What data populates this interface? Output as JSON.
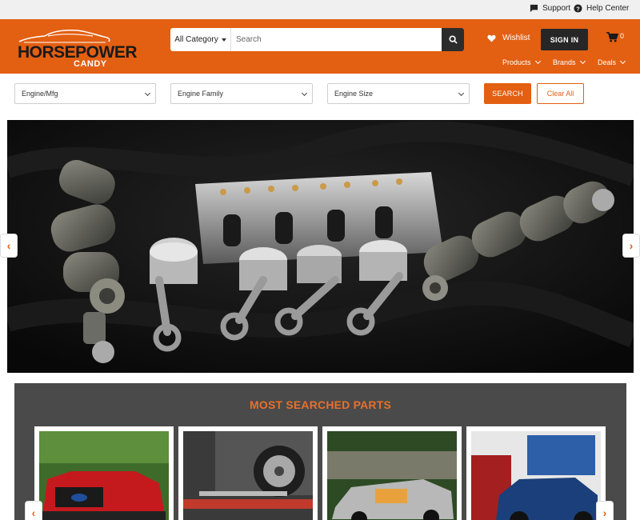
{
  "topbar": {
    "support": "Support",
    "help": "Help Center"
  },
  "brand": {
    "line1": "HORSEPOWER",
    "line2": "CANDY"
  },
  "search": {
    "category": "All Category",
    "placeholder": "Search"
  },
  "header": {
    "wishlist": "Wishlist",
    "signin": "SIGN IN",
    "cart_count": "0"
  },
  "nav": [
    "Products",
    "Brands",
    "Deals"
  ],
  "filters": {
    "engine_mfg": "Engine/Mfg",
    "engine_family": "Engine Family",
    "engine_size": "Engine Size",
    "search_btn": "SEARCH",
    "clear_btn": "Clear All"
  },
  "carousel": {
    "prev": "‹",
    "next": "›"
  },
  "most_searched": {
    "title": "MOST SEARCHED PARTS",
    "prev": "‹",
    "next": "›"
  },
  "colors": {
    "brand_orange": "#e35f12",
    "dark": "#262626",
    "panel": "#4a4a4a"
  }
}
